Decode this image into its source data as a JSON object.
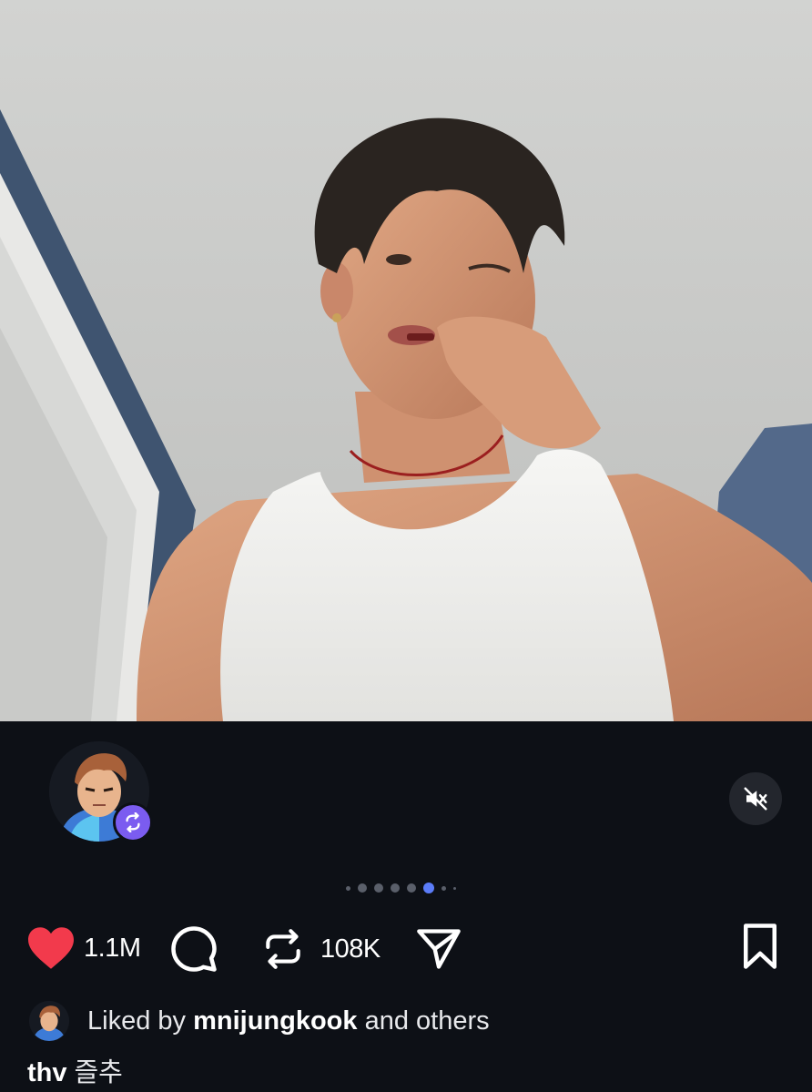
{
  "post": {
    "image_alt": "Selfie of a young man in a white tank top with dark tousled hair",
    "carousel": {
      "total": 8,
      "active_index": 5
    },
    "author_avatar_icon": "cartoon-avatar-icon",
    "repost_badge_icon": "repost-icon",
    "mute_icon": "speaker-muted-icon"
  },
  "actions": {
    "like_count": "1.1M",
    "repost_count": "108K",
    "like_icon": "heart-filled-icon",
    "comment_icon": "comment-bubble-icon",
    "repost_icon": "repost-arrows-icon",
    "share_icon": "send-icon",
    "save_icon": "bookmark-icon"
  },
  "likes": {
    "prefix": "Liked by",
    "user": "mnijungkook",
    "suffix": "and others"
  },
  "caption": {
    "username": "thv",
    "text": "즐추"
  },
  "colors": {
    "background": "#0d1016",
    "like_red": "#f23a4c",
    "accent_purple": "#7b5cf0",
    "dot_active": "#5b7cf8"
  }
}
